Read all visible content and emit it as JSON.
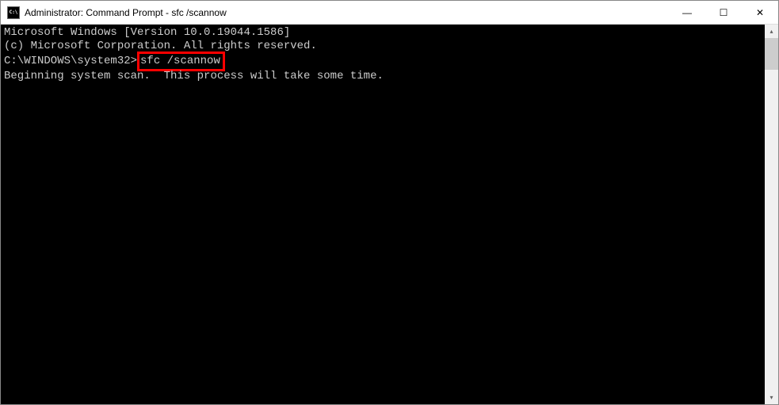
{
  "window": {
    "title": "Administrator: Command Prompt - sfc  /scannow",
    "icon_text": "C:\\"
  },
  "terminal": {
    "line1": "Microsoft Windows [Version 10.0.19044.1586]",
    "line2": "(c) Microsoft Corporation. All rights reserved.",
    "blank1": "",
    "prompt": "C:\\WINDOWS\\system32>",
    "command": "sfc /scannow",
    "blank2": "",
    "status": "Beginning system scan.  This process will take some time."
  },
  "controls": {
    "minimize": "—",
    "maximize": "☐",
    "close": "✕",
    "scroll_up": "▴",
    "scroll_down": "▾"
  }
}
